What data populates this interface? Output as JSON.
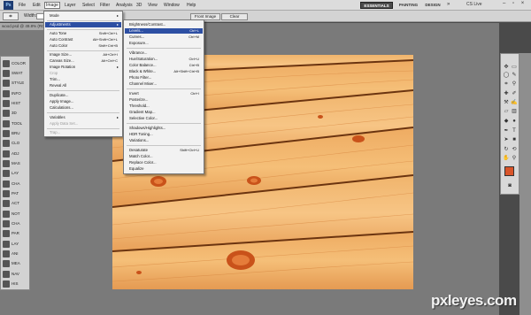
{
  "menubar": {
    "logo": "Ps",
    "items": [
      "File",
      "Edit",
      "Image",
      "Layer",
      "Select",
      "Filter",
      "Analysis",
      "3D",
      "View",
      "Window",
      "Help"
    ],
    "workspaces": [
      "ESSENTIALS",
      "PAINTING",
      "DESIGN"
    ],
    "more": "»",
    "cs_live": "CS Live",
    "window_buttons": "– ▫ ×"
  },
  "options": {
    "width_label": "Width:",
    "front_image": "Front Image",
    "clear": "Clear"
  },
  "document": {
    "tab_title": "wood.psd @ 49.8% (RGB/8)"
  },
  "image_menu": {
    "items": [
      {
        "label": "Mode",
        "shortcut": "",
        "submenu": true,
        "state": "normal"
      },
      {
        "label": "Adjustments",
        "shortcut": "",
        "submenu": true,
        "state": "highlighted"
      },
      {
        "label": "Auto Tone",
        "shortcut": "Shift+Ctrl+L",
        "submenu": false,
        "state": "normal"
      },
      {
        "label": "Auto Contrast",
        "shortcut": "Alt+Shift+Ctrl+L",
        "submenu": false,
        "state": "normal"
      },
      {
        "label": "Auto Color",
        "shortcut": "Shift+Ctrl+B",
        "submenu": false,
        "state": "normal"
      },
      {
        "label": "Image Size...",
        "shortcut": "Alt+Ctrl+I",
        "submenu": false,
        "state": "normal"
      },
      {
        "label": "Canvas Size...",
        "shortcut": "Alt+Ctrl+C",
        "submenu": false,
        "state": "normal"
      },
      {
        "label": "Image Rotation",
        "shortcut": "",
        "submenu": true,
        "state": "normal"
      },
      {
        "label": "Crop",
        "shortcut": "",
        "submenu": false,
        "state": "disabled"
      },
      {
        "label": "Trim...",
        "shortcut": "",
        "submenu": false,
        "state": "normal"
      },
      {
        "label": "Reveal All",
        "shortcut": "",
        "submenu": false,
        "state": "normal"
      },
      {
        "label": "Duplicate...",
        "shortcut": "",
        "submenu": false,
        "state": "normal"
      },
      {
        "label": "Apply Image...",
        "shortcut": "",
        "submenu": false,
        "state": "normal"
      },
      {
        "label": "Calculations...",
        "shortcut": "",
        "submenu": false,
        "state": "normal"
      },
      {
        "label": "Variables",
        "shortcut": "",
        "submenu": true,
        "state": "normal"
      },
      {
        "label": "Apply Data Set...",
        "shortcut": "",
        "submenu": false,
        "state": "disabled"
      },
      {
        "label": "Trap...",
        "shortcut": "",
        "submenu": false,
        "state": "disabled"
      }
    ]
  },
  "adjust_menu": {
    "items": [
      {
        "label": "Brightness/Contrast...",
        "shortcut": "",
        "state": "normal"
      },
      {
        "label": "Levels...",
        "shortcut": "Ctrl+L",
        "state": "highlighted"
      },
      {
        "label": "Curves...",
        "shortcut": "Ctrl+M",
        "state": "normal"
      },
      {
        "label": "Exposure...",
        "shortcut": "",
        "state": "normal"
      },
      {
        "label": "Vibrance...",
        "shortcut": "",
        "state": "normal"
      },
      {
        "label": "Hue/Saturation...",
        "shortcut": "Ctrl+U",
        "state": "normal"
      },
      {
        "label": "Color Balance...",
        "shortcut": "Ctrl+B",
        "state": "normal"
      },
      {
        "label": "Black & White...",
        "shortcut": "Alt+Shift+Ctrl+B",
        "state": "normal"
      },
      {
        "label": "Photo Filter...",
        "shortcut": "",
        "state": "normal"
      },
      {
        "label": "Channel Mixer...",
        "shortcut": "",
        "state": "normal"
      },
      {
        "label": "Invert",
        "shortcut": "Ctrl+I",
        "state": "normal"
      },
      {
        "label": "Posterize...",
        "shortcut": "",
        "state": "normal"
      },
      {
        "label": "Threshold...",
        "shortcut": "",
        "state": "normal"
      },
      {
        "label": "Gradient Map...",
        "shortcut": "",
        "state": "normal"
      },
      {
        "label": "Selective Color...",
        "shortcut": "",
        "state": "normal"
      },
      {
        "label": "Shadows/Highlights...",
        "shortcut": "",
        "state": "normal"
      },
      {
        "label": "HDR Toning...",
        "shortcut": "",
        "state": "normal"
      },
      {
        "label": "Variations...",
        "shortcut": "",
        "state": "normal"
      },
      {
        "label": "Desaturate",
        "shortcut": "Shift+Ctrl+U",
        "state": "normal"
      },
      {
        "label": "Match Color...",
        "shortcut": "",
        "state": "normal"
      },
      {
        "label": "Replace Color...",
        "shortcut": "",
        "state": "normal"
      },
      {
        "label": "Equalize",
        "shortcut": "",
        "state": "normal"
      }
    ]
  },
  "left_panel": {
    "items": [
      {
        "label": "COLOR",
        "icon": "color-icon"
      },
      {
        "label": "SWAT",
        "icon": "swatches-icon"
      },
      {
        "label": "STYLE",
        "icon": "styles-icon"
      },
      {
        "label": "INFO",
        "icon": "info-icon"
      },
      {
        "label": "HIST",
        "icon": "histogram-icon"
      },
      {
        "label": "3D",
        "icon": "3d-icon"
      },
      {
        "label": "TOOL",
        "icon": "tool-presets-icon"
      },
      {
        "label": "BRU",
        "icon": "brush-icon"
      },
      {
        "label": "CLO",
        "icon": "clone-source-icon"
      },
      {
        "label": "ADJ",
        "icon": "adjustments-icon"
      },
      {
        "label": "MAS",
        "icon": "masks-icon"
      },
      {
        "label": "LAY",
        "icon": "layers-icon"
      },
      {
        "label": "CHA",
        "icon": "channels-icon"
      },
      {
        "label": "PAT",
        "icon": "paths-icon"
      },
      {
        "label": "ACT",
        "icon": "actions-icon"
      },
      {
        "label": "NOT",
        "icon": "notes-icon"
      },
      {
        "label": "CHA",
        "icon": "character-icon"
      },
      {
        "label": "PAR",
        "icon": "paragraph-icon"
      },
      {
        "label": "LAY",
        "icon": "layer-comps-icon"
      },
      {
        "label": "ANI",
        "icon": "animation-icon"
      },
      {
        "label": "MEA",
        "icon": "measurement-log-icon"
      },
      {
        "label": "NAV",
        "icon": "navigator-icon"
      },
      {
        "label": "HIS",
        "icon": "history-icon"
      }
    ]
  },
  "colors": {
    "foreground": "#d9552a",
    "background": "#ffffff",
    "menu_highlight": "#2d4fa3",
    "wood_base": "#e9a25a"
  },
  "watermark": "pxleyes.com"
}
